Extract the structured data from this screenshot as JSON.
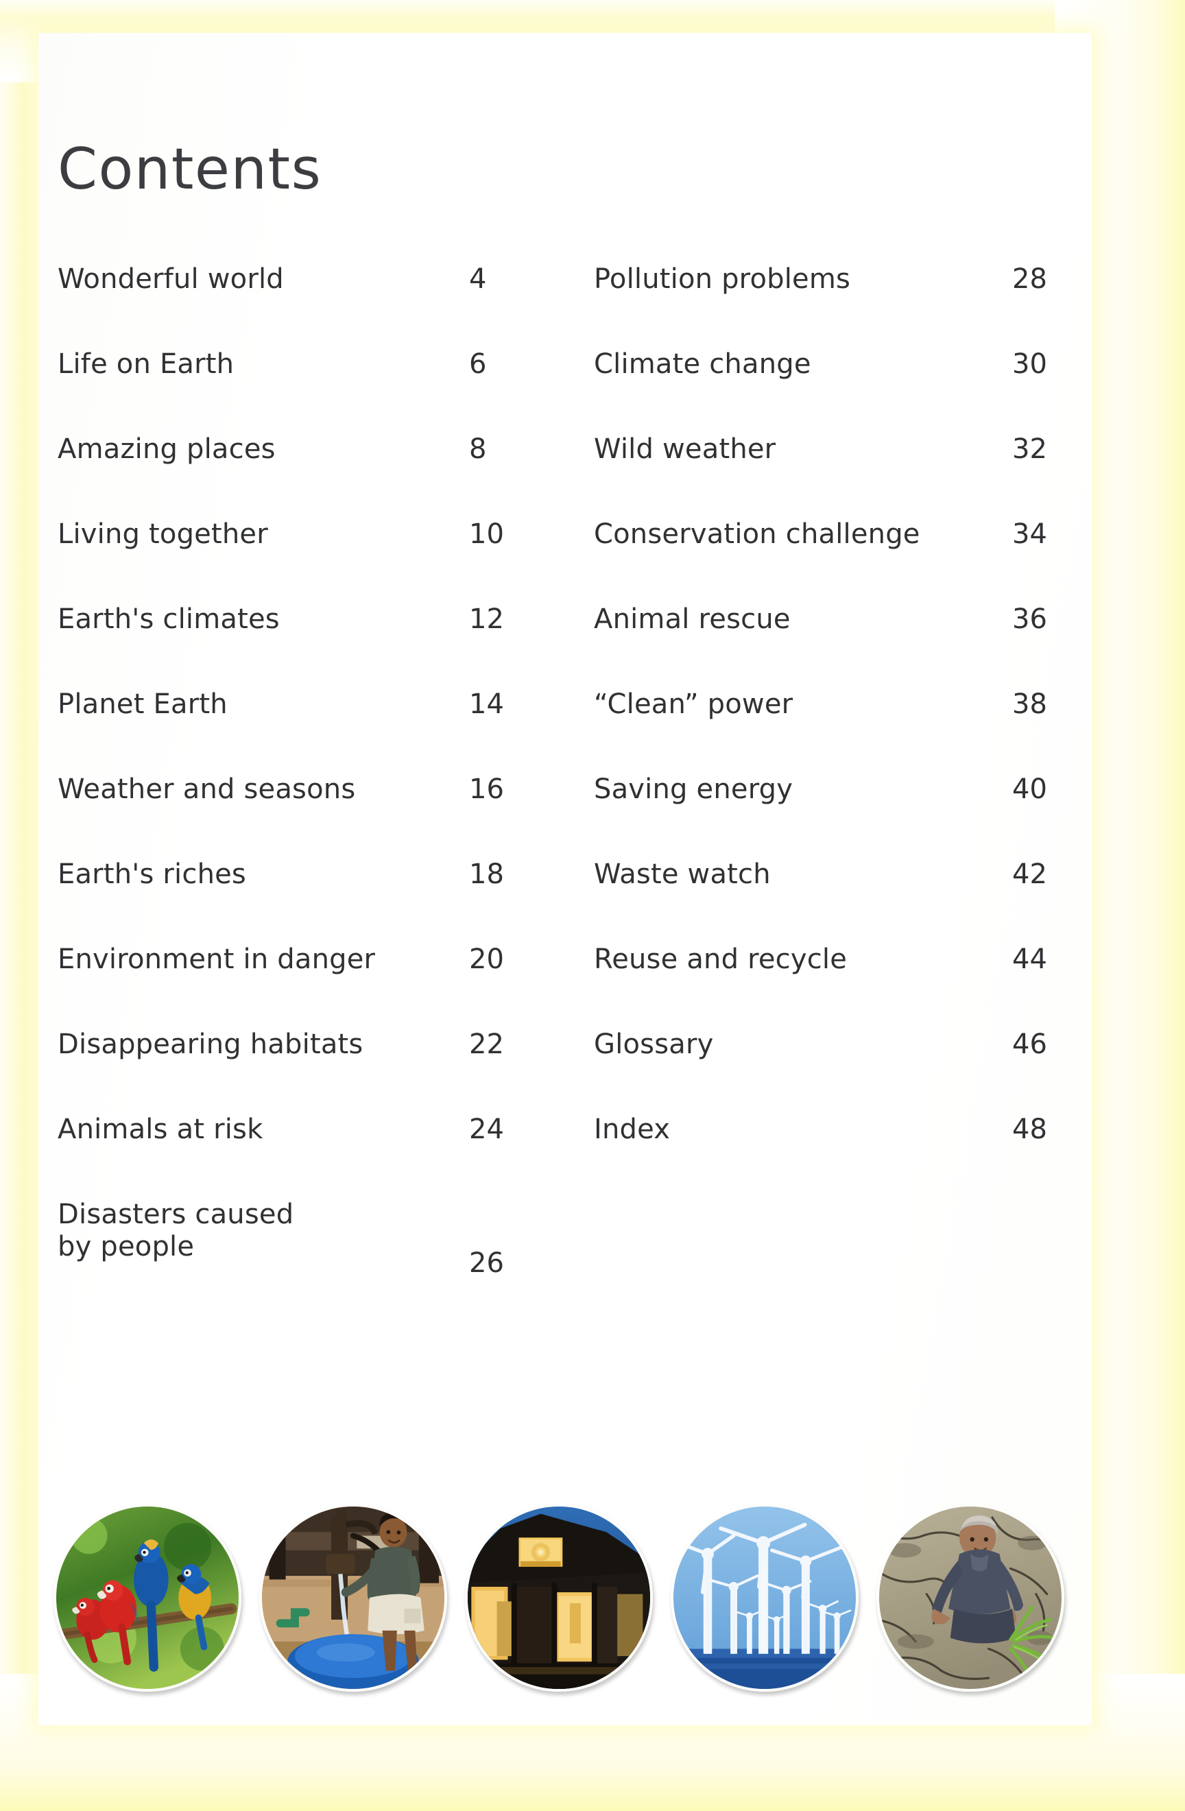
{
  "page": {
    "title": "Contents",
    "background_color": "#ffffff",
    "scan_glow_color": "#fdfbc8",
    "text_color": "#2f3133"
  },
  "toc": {
    "left_column": [
      {
        "label": "Wonderful world",
        "page": "4"
      },
      {
        "label": "Life on Earth",
        "page": "6"
      },
      {
        "label": "Amazing places",
        "page": "8"
      },
      {
        "label": "Living together",
        "page": "10"
      },
      {
        "label": "Earth's climates",
        "page": "12"
      },
      {
        "label": "Planet Earth",
        "page": "14"
      },
      {
        "label": "Weather and seasons",
        "page": "16"
      },
      {
        "label": "Earth's riches",
        "page": "18"
      },
      {
        "label": "Environment in danger",
        "page": "20"
      },
      {
        "label": "Disappearing habitats",
        "page": "22"
      },
      {
        "label": "Animals at risk",
        "page": "24"
      },
      {
        "label": "Disasters caused\nby people",
        "page": "26"
      }
    ],
    "right_column": [
      {
        "label": "Pollution problems",
        "page": "28"
      },
      {
        "label": "Climate change",
        "page": "30"
      },
      {
        "label": "Wild weather",
        "page": "32"
      },
      {
        "label": "Conservation challenge",
        "page": "34"
      },
      {
        "label": "Animal rescue",
        "page": "36"
      },
      {
        "label": "“Clean” power",
        "page": "38"
      },
      {
        "label": "Saving energy",
        "page": "40"
      },
      {
        "label": "Waste watch",
        "page": "42"
      },
      {
        "label": "Reuse and recycle",
        "page": "44"
      },
      {
        "label": "Glossary",
        "page": "46"
      },
      {
        "label": "Index",
        "page": "48"
      }
    ]
  },
  "photo_strip": [
    {
      "name": "macaws-photo",
      "alt": "Red and blue macaws perched on a branch in green foliage"
    },
    {
      "name": "water-pump-photo",
      "alt": "Boy pumping water from a village hand pump into a blue basin"
    },
    {
      "name": "lit-house-photo",
      "alt": "House at night with windows glowing warm yellow light"
    },
    {
      "name": "wind-turbines-photo",
      "alt": "Offshore wind turbines against a blue sky and sea"
    },
    {
      "name": "drought-farmer-photo",
      "alt": "Farmer crouching on cracked dry earth holding green shoots"
    }
  ]
}
